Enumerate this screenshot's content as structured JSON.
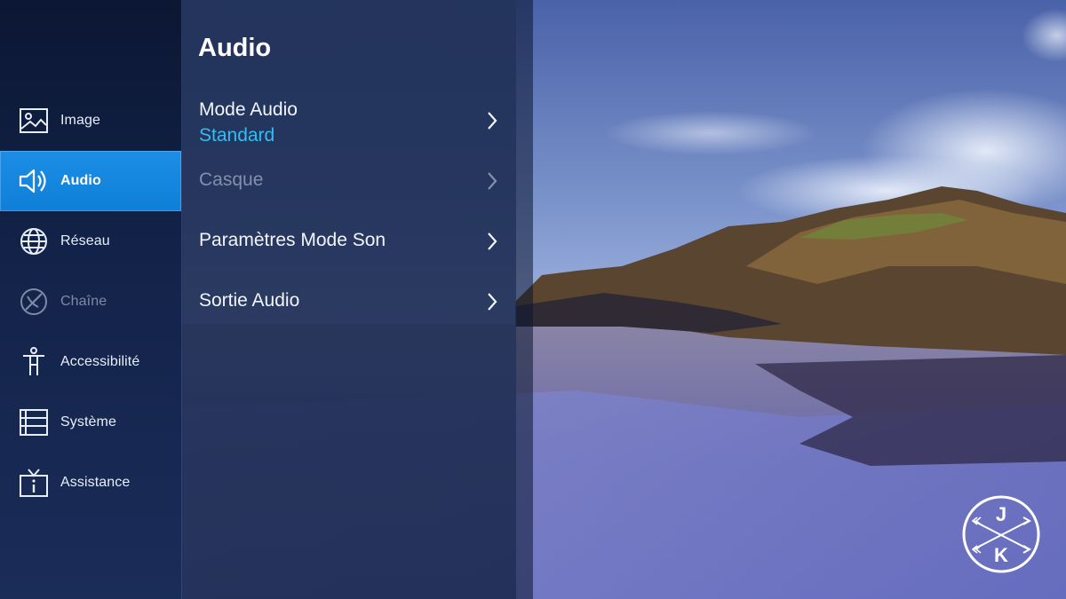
{
  "sidebar": {
    "items": [
      {
        "label": "Image",
        "icon": "image-icon",
        "state": "normal"
      },
      {
        "label": "Audio",
        "icon": "speaker-icon",
        "state": "active"
      },
      {
        "label": "Réseau",
        "icon": "globe-icon",
        "state": "normal"
      },
      {
        "label": "Chaîne",
        "icon": "antenna-icon",
        "state": "disabled"
      },
      {
        "label": "Accessibilité",
        "icon": "accessibility-icon",
        "state": "normal"
      },
      {
        "label": "Système",
        "icon": "system-list-icon",
        "state": "normal"
      },
      {
        "label": "Assistance",
        "icon": "tv-info-icon",
        "state": "normal"
      }
    ]
  },
  "panel": {
    "title": "Audio",
    "items": [
      {
        "label": "Mode Audio",
        "value": "Standard",
        "state": "normal"
      },
      {
        "label": "Casque",
        "state": "disabled"
      },
      {
        "label": "Paramètres Mode Son",
        "state": "normal"
      },
      {
        "label": "Sortie Audio",
        "state": "normal"
      }
    ]
  },
  "watermark": {
    "top_letter": "J",
    "bottom_letter": "K"
  },
  "colors": {
    "accent": "#1b8fe6",
    "value_text": "#33bdf5",
    "sidebar_bg": "#13234a",
    "panel_bg": "#23345c"
  }
}
